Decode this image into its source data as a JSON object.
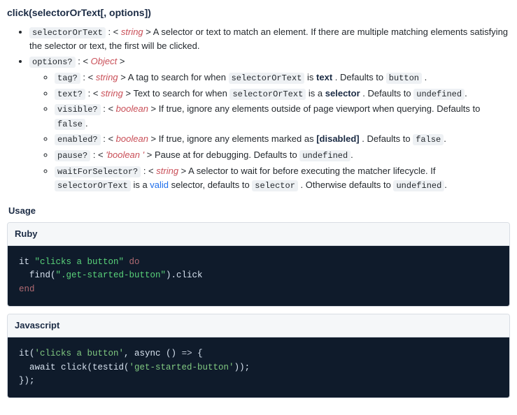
{
  "signature": "click(selectorOrText[, options])",
  "param_selector": {
    "name": "selectorOrText",
    "type": "string",
    "desc_before": "A selector or text to match an element. If there are multiple matching elements satisfying the selector or text, the first will be clicked."
  },
  "param_options": {
    "name": "options?",
    "type": "Object"
  },
  "opts": {
    "tag": {
      "name": "tag?",
      "type": "string",
      "text_before": "A tag to search for when ",
      "code1": "selectorOrText",
      "text_mid": " is ",
      "bold": "text",
      "text_after": " . Defaults to ",
      "def": "button",
      "tail": " ."
    },
    "text": {
      "name": "text?",
      "type": "string",
      "text_before": "Text to search for when ",
      "code1": "selectorOrText",
      "text_mid": " is a ",
      "bold": "selector",
      "text_after": " . Defaults to ",
      "def": "undefined",
      "tail": "."
    },
    "visible": {
      "name": "visible?",
      "type": "boolean",
      "desc": "If true, ignore any elements outside of page viewport when querying. Defaults to ",
      "def": "false",
      "tail": "."
    },
    "enabled": {
      "name": "enabled?",
      "type": "boolean",
      "desc": "If true, ignore any elements marked as ",
      "bold": "[disabled]",
      "text_after": " . Defaults to ",
      "def": "false",
      "tail": "."
    },
    "pause": {
      "name": "pause?",
      "type": "'boolean '",
      "desc": "Pause at for debugging. Defaults to ",
      "def": "undefined",
      "tail": "."
    },
    "waitForSelector": {
      "name": "waitForSelector?",
      "type": "string",
      "desc": "A selector to wait for before executing the matcher lifecycle. If ",
      "code1": "selectorOrText",
      "text_mid": " is a ",
      "link": "valid",
      "text_after1": " selector, defaults to ",
      "def1": "selector",
      "text_after2": " . Otherwise defaults to ",
      "def2": "undefined",
      "tail": "."
    }
  },
  "usage_heading": "Usage",
  "ruby": {
    "title": "Ruby",
    "l1_a": "it ",
    "l1_b": "\"clicks a button\"",
    "l1_c": " do",
    "l2_a": "  find(",
    "l2_b": "\".get-started-button\"",
    "l2_c": ").click",
    "l3": "end"
  },
  "js": {
    "title": "Javascript",
    "l1_a": "it(",
    "l1_b": "'clicks a button'",
    "l1_c": ", async () ",
    "l1_d": "=>",
    "l1_e": " {",
    "l2_a": "  await click(testid(",
    "l2_b": "'get-started-button'",
    "l2_c": "));",
    "l3": "});"
  }
}
